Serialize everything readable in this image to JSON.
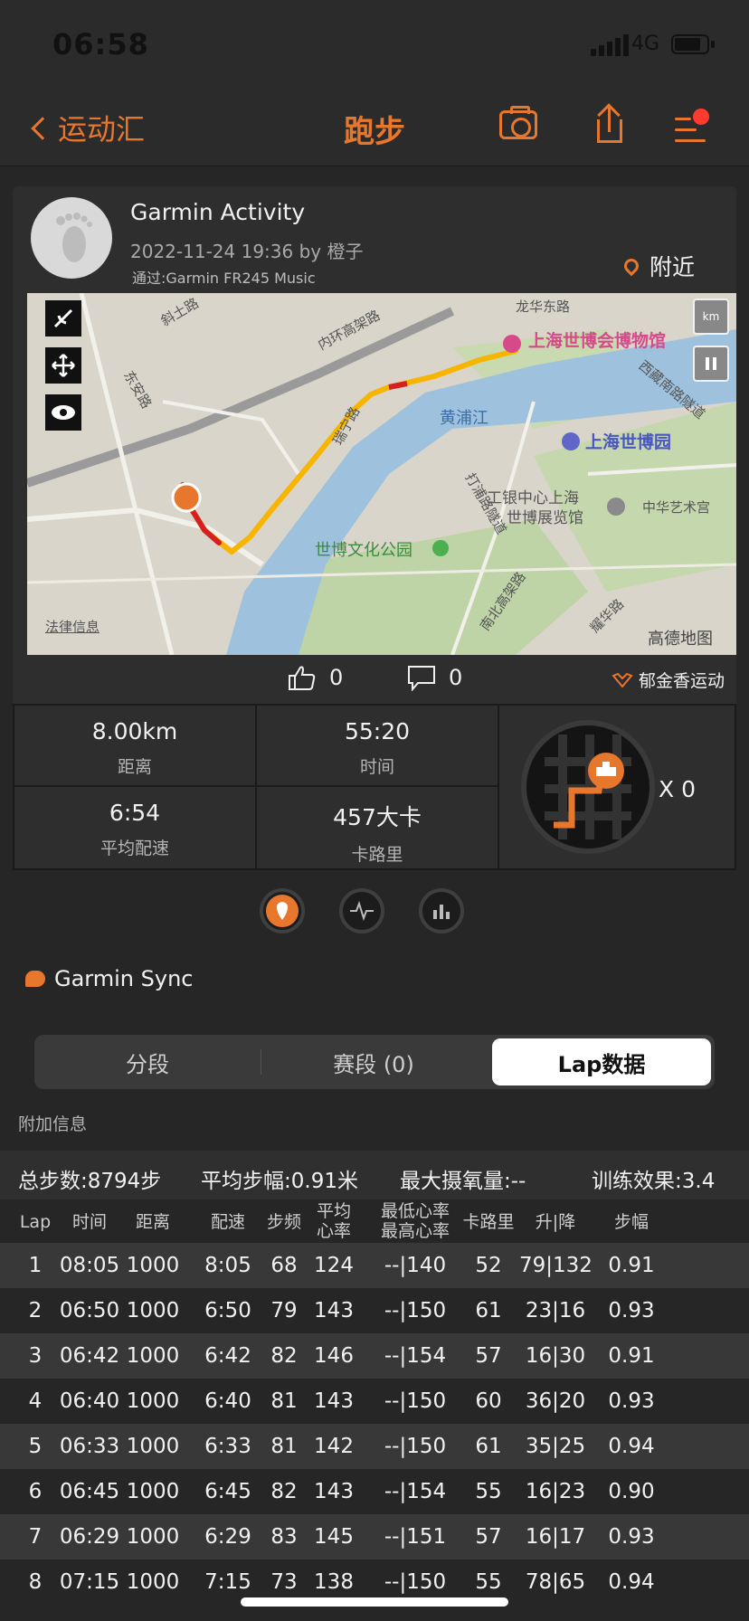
{
  "status": {
    "time": "06:58",
    "network": "4G"
  },
  "nav": {
    "back_label": "运动汇",
    "title": "跑步"
  },
  "activity": {
    "title": "Garmin Activity",
    "date_line": "2022-11-24 19:36 by 橙子",
    "device_line": "通过:Garmin FR245 Music",
    "nearby_label": "附近"
  },
  "map": {
    "labels": [
      "上海世博会博物馆",
      "上海世博园",
      "黄浦江",
      "世博文化公园",
      "工银中心上海",
      "世博展览馆",
      "中华艺术宫",
      "龙华东路",
      "斜土路",
      "内环高架路",
      "东安路",
      "瑞宁路",
      "打浦路隧道",
      "南北高架路",
      "耀华路",
      "西藏南路隧道",
      "法律信息",
      "高德地图"
    ],
    "km_label": "km"
  },
  "social": {
    "likes": "0",
    "comments": "0",
    "brand": "郁金香运动"
  },
  "stats": {
    "distance_value": "8.00km",
    "distance_label": "距离",
    "time_value": "55:20",
    "time_label": "时间",
    "pace_value": "6:54",
    "pace_label": "平均配速",
    "calories_value": "457大卡",
    "calories_label": "卡路里",
    "medal_count": "X 0"
  },
  "sync_label": "Garmin Sync",
  "tabs": {
    "split": "分段",
    "segment": "赛段 (0)",
    "lap": "Lap数据"
  },
  "extra_label": "附加信息",
  "summary": {
    "steps": "总步数:8794步",
    "stride": "平均步幅:0.91米",
    "vo2": "最大摄氧量:--",
    "effect": "训练效果:3.4"
  },
  "table": {
    "headers": [
      "Lap",
      "时间",
      "距离",
      "配速",
      "步频",
      "平均\n心率",
      "最低心率\n最高心率",
      "卡路里",
      "升|降",
      "步幅"
    ],
    "rows": [
      [
        "1",
        "08:05",
        "1000",
        "8:05",
        "68",
        "124",
        "--|140",
        "52",
        "79|132",
        "0.91"
      ],
      [
        "2",
        "06:50",
        "1000",
        "6:50",
        "79",
        "143",
        "--|150",
        "61",
        "23|16",
        "0.93"
      ],
      [
        "3",
        "06:42",
        "1000",
        "6:42",
        "82",
        "146",
        "--|154",
        "57",
        "16|30",
        "0.91"
      ],
      [
        "4",
        "06:40",
        "1000",
        "6:40",
        "81",
        "143",
        "--|150",
        "60",
        "36|20",
        "0.93"
      ],
      [
        "5",
        "06:33",
        "1000",
        "6:33",
        "81",
        "142",
        "--|150",
        "61",
        "35|25",
        "0.94"
      ],
      [
        "6",
        "06:45",
        "1000",
        "6:45",
        "82",
        "143",
        "--|154",
        "55",
        "16|23",
        "0.90"
      ],
      [
        "7",
        "06:29",
        "1000",
        "6:29",
        "83",
        "145",
        "--|151",
        "57",
        "16|17",
        "0.93"
      ],
      [
        "8",
        "07:15",
        "1000",
        "7:15",
        "73",
        "138",
        "--|150",
        "55",
        "78|65",
        "0.94"
      ]
    ]
  },
  "colors": {
    "accent": "#e8772e",
    "background": "#262626",
    "route": "#f7b500",
    "route_hot": "#d62020"
  }
}
